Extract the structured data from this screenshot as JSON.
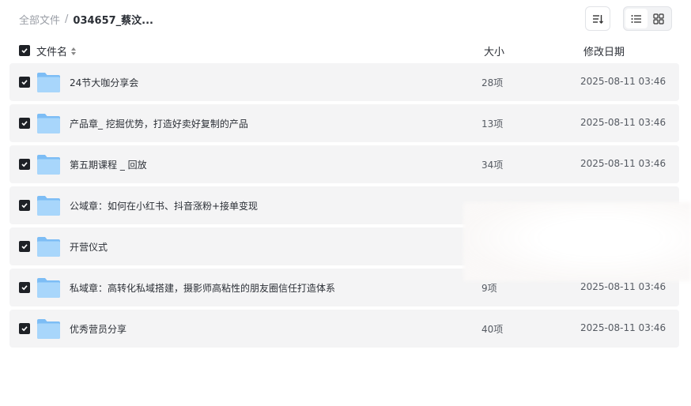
{
  "breadcrumb": {
    "root": "全部文件",
    "separator": "/",
    "current": "034657_蔡汶..."
  },
  "toolbar": {
    "sort_icon": "sort-icon",
    "view_list_icon": "list-view-icon",
    "view_grid_icon": "grid-view-icon"
  },
  "table": {
    "headers": {
      "name": "文件名",
      "size": "大小",
      "modified": "修改日期"
    },
    "rows": [
      {
        "name": "24节大咖分享会",
        "size": "28项",
        "modified": "2025-08-11 03:46"
      },
      {
        "name": "产品章_ 挖掘优势，打造好卖好复制的产品",
        "size": "13项",
        "modified": "2025-08-11 03:46"
      },
      {
        "name": "第五期课程 _ 回放",
        "size": "34项",
        "modified": "2025-08-11 03:46"
      },
      {
        "name": "公域章：如何在小红书、抖音涨粉+接单变现",
        "size": "",
        "modified": ""
      },
      {
        "name": "开营仪式",
        "size": "",
        "modified": ""
      },
      {
        "name": "私域章：高转化私域搭建，摄影师高粘性的朋友圈信任打造体系",
        "size": "9项",
        "modified": "2025-08-11 03:46"
      },
      {
        "name": "优秀营员分享",
        "size": "40项",
        "modified": "2025-08-11 03:46"
      }
    ]
  },
  "colors": {
    "row_bg": "#f4f4f5",
    "checkbox": "#1e2126",
    "folder_light": "#a8d6fb",
    "folder_dark": "#7dbdf5"
  }
}
